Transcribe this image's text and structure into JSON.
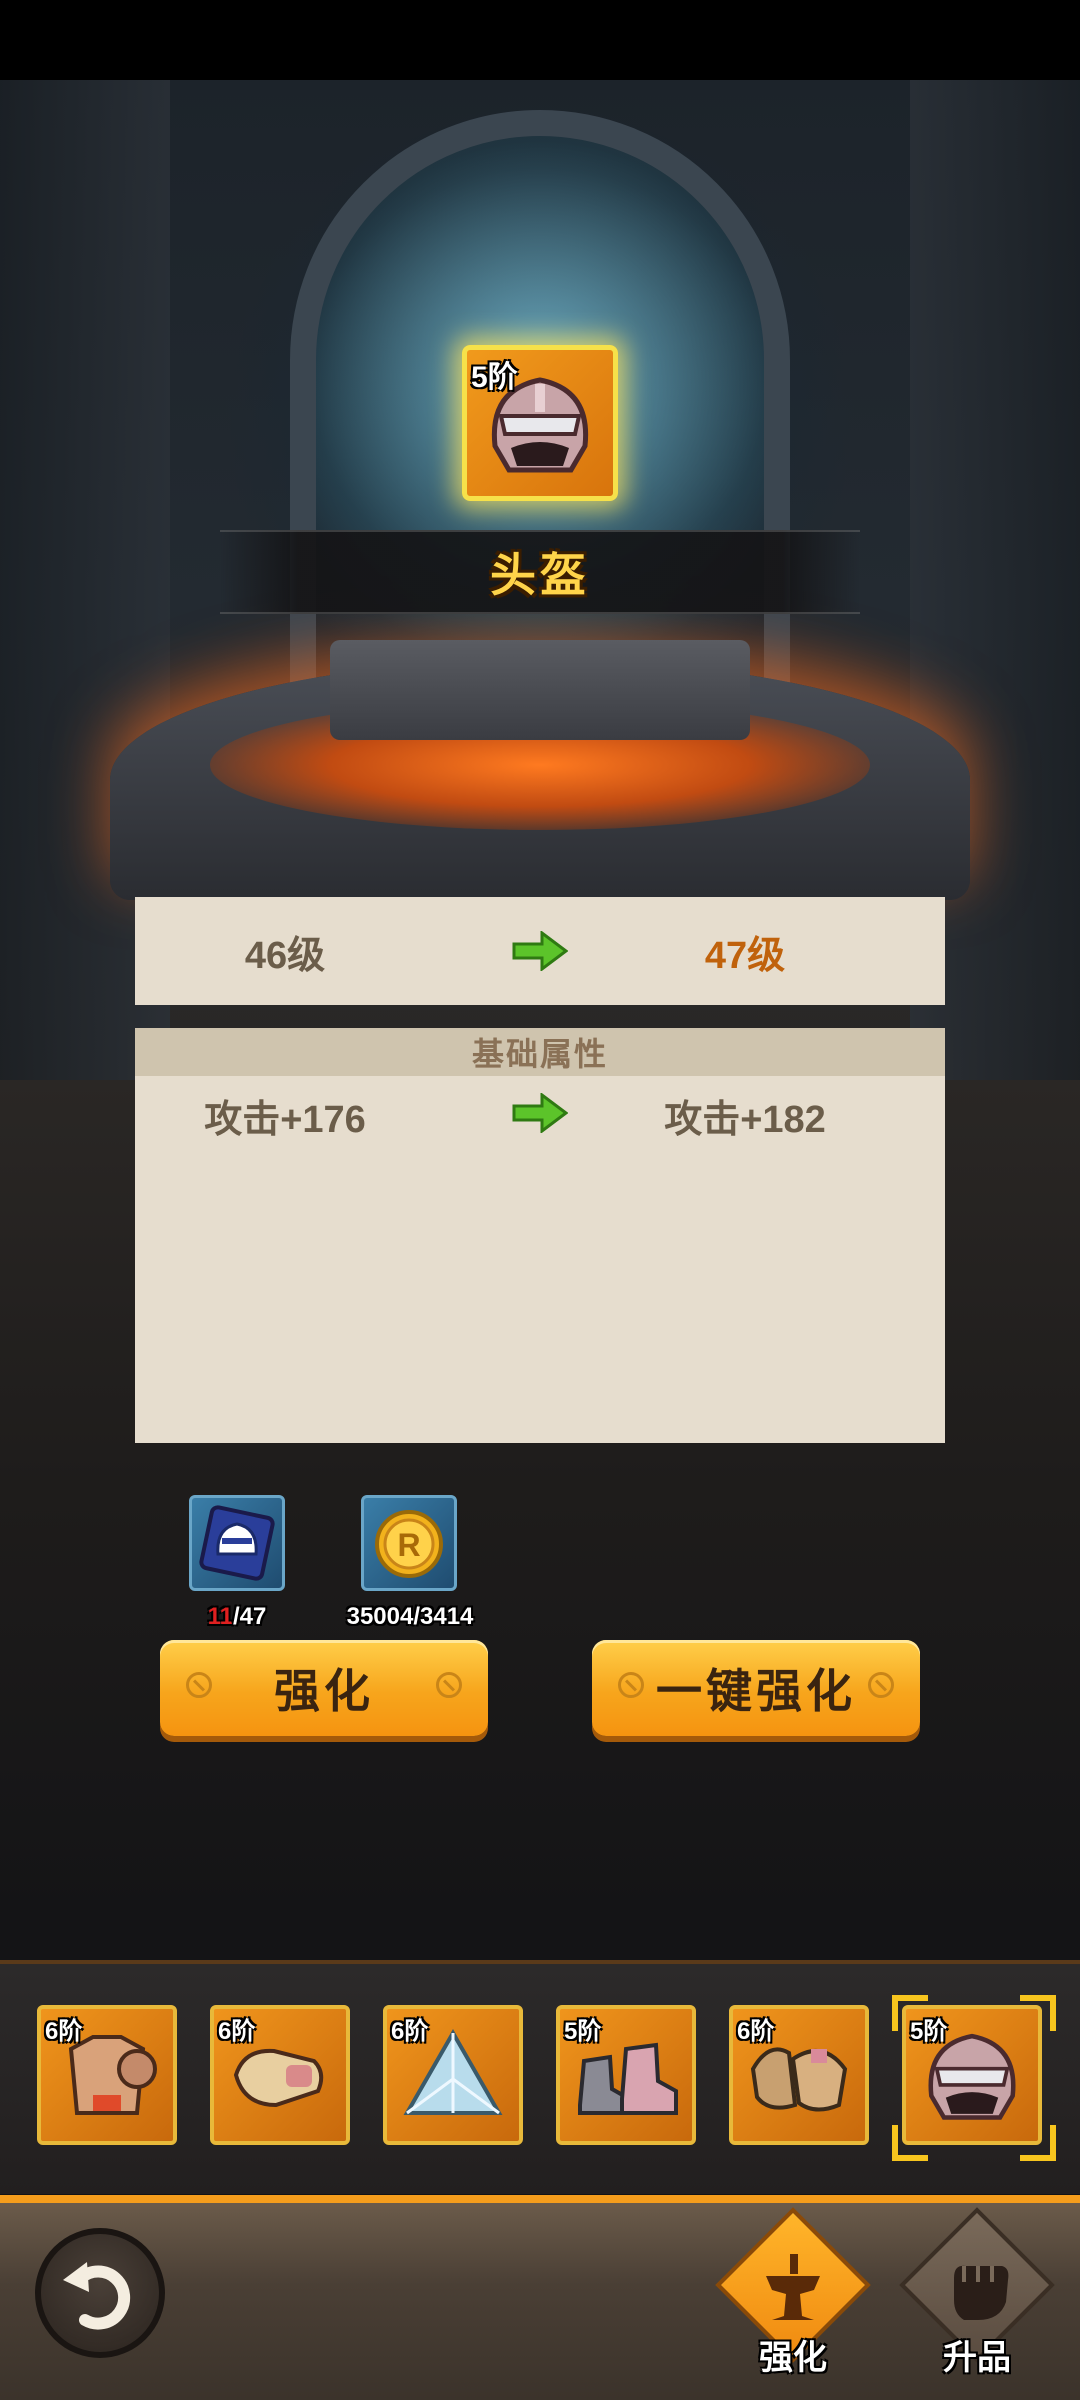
{
  "equipment": {
    "name": "头盔",
    "tier": "5阶",
    "icon": "helmet-icon"
  },
  "level": {
    "current": "46级",
    "next": "47级"
  },
  "stats": {
    "header": "基础属性",
    "rows": [
      {
        "current": "攻击+176",
        "next": "攻击+182"
      }
    ]
  },
  "resources": [
    {
      "icon": "helmet-scroll-icon",
      "have": "11",
      "need": "/47"
    },
    {
      "icon": "coin-icon",
      "label": "35004/3414"
    }
  ],
  "buttons": {
    "enhance": "强化",
    "one_click_enhance": "一键强化"
  },
  "slots": [
    {
      "tier": "6阶",
      "icon": "armor-icon"
    },
    {
      "tier": "6阶",
      "icon": "gauntlet-icon"
    },
    {
      "tier": "6阶",
      "icon": "crystal-icon"
    },
    {
      "tier": "5阶",
      "icon": "boots-icon"
    },
    {
      "tier": "6阶",
      "icon": "gloves-icon"
    },
    {
      "tier": "5阶",
      "icon": "helmet-icon",
      "selected": true
    }
  ],
  "nav": {
    "tab_enhance": "强化",
    "tab_upgrade": "升品"
  },
  "colors": {
    "accent": "#f7a51c",
    "level_next": "#c0620c",
    "need_red": "#e02020"
  }
}
